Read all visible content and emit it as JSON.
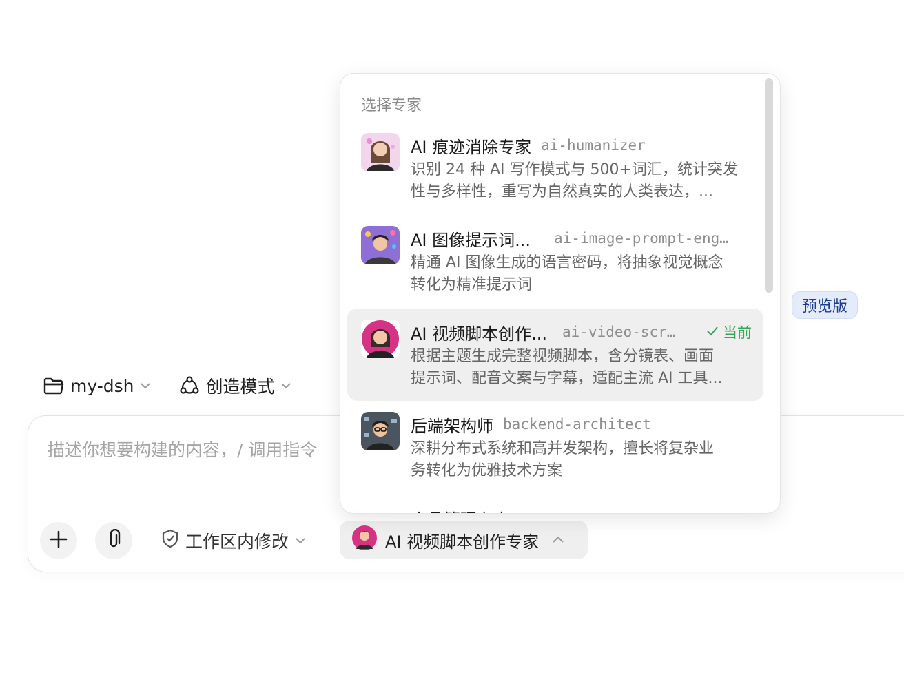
{
  "context": {
    "folder_label": "my-dsh",
    "mode_label": "创造模式"
  },
  "preview_badge": "预览版",
  "composer": {
    "placeholder": "描述你想要构建的内容，/ 调用指令",
    "permission_label": "工作区内修改",
    "expert_label": "AI 视频脚本创作专家"
  },
  "dropdown": {
    "title": "选择专家",
    "current_label": "当前",
    "items": [
      {
        "name": "AI 痕迹消除专家",
        "slug": "ai-humanizer",
        "desc1": "识别 24 种 AI 写作模式与 500+词汇，统计突发",
        "desc2": "性与多样性，重写为自然真实的人类表达，..."
      },
      {
        "name": "AI 图像提示词...",
        "slug": "ai-image-prompt-eng…",
        "desc1": "精通 AI 图像生成的语言密码，将抽象视觉概念",
        "desc2": "转化为精准提示词"
      },
      {
        "name": "AI 视频脚本创作...",
        "slug": "ai-video-scr…",
        "desc1": "根据主题生成完整视频脚本，含分镜表、画面",
        "desc2": "提示词、配音文案与字幕，适配主流 AI 工具..."
      },
      {
        "name": "后端架构师",
        "slug": "backend-architect",
        "desc1": "深耕分布式系统和高并发架构，擅长将复杂业",
        "desc2": "务转化为优雅技术方案"
      }
    ],
    "partial_item": "产品管理专家"
  }
}
